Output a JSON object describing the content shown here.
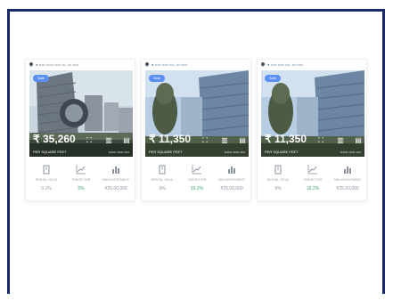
{
  "cards": [
    {
      "address": "● ••••• •••••• ••••• •••, ••• •••••",
      "badge": "Sale",
      "price": "₹ 35,260",
      "price_unit": "PER SQUARE FEET",
      "meta": "•••••• ••••• ••••",
      "stats": [
        {
          "label": "RENTAL YIELD",
          "value": "0.1%"
        },
        {
          "label": "TARGET IRR",
          "value": "5%"
        },
        {
          "label": "MIN INVESTMENT",
          "value": "₹25,00,000"
        }
      ]
    },
    {
      "address": "● ••••• ••••• ••••, ••• •••••",
      "badge": "Sale",
      "price": "₹ 11,350",
      "price_unit": "PER SQUARE FEET",
      "meta": "•••••• ••••• ••••",
      "stats": [
        {
          "label": "RENTAL YIELD",
          "value": "9%"
        },
        {
          "label": "TARGET IRR",
          "value": "16.2%"
        },
        {
          "label": "MIN INVESTMENT",
          "value": "₹25,00,000"
        }
      ]
    },
    {
      "address": "● ••••• ••••• ••••, ••• •••••",
      "badge": "Sale",
      "price": "₹ 11,350",
      "price_unit": "PER SQUARE FEET",
      "meta": "•••••• ••••• ••••",
      "stats": [
        {
          "label": "RENTAL YIELD",
          "value": "9%"
        },
        {
          "label": "TARGET IRR",
          "value": "16.2%"
        },
        {
          "label": "MIN INVESTMENT",
          "value": "₹25,00,000"
        }
      ]
    }
  ],
  "icons": [
    "map-pin-icon",
    "building-icon",
    "chart-line-icon",
    "bar-chart-icon",
    "fullscreen-icon",
    "document-icon"
  ],
  "colors": {
    "frame": "#1b2a6b",
    "badge": "#5b8ff2",
    "positive": "#3aa66b"
  }
}
